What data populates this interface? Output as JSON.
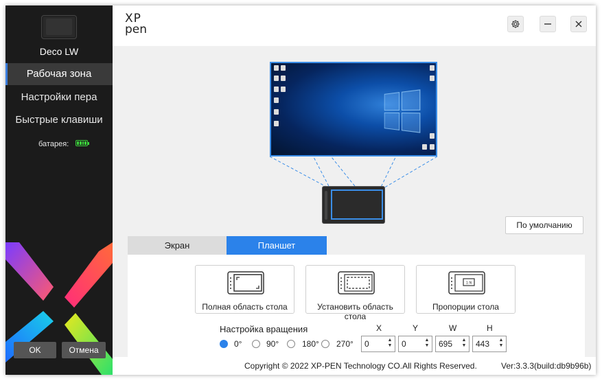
{
  "sidebar": {
    "device_name": "Deco LW",
    "items": [
      {
        "label": "Рабочая зона",
        "active": true
      },
      {
        "label": "Настройки пера",
        "active": false
      },
      {
        "label": "Быстрые клавиши",
        "active": false
      }
    ],
    "battery_label": "батарея:",
    "ok_label": "OK",
    "cancel_label": "Отмена"
  },
  "header": {
    "logo_line1": "XP",
    "logo_line2": "pen",
    "settings_icon": "gear-icon",
    "minimize_icon": "minimize-icon",
    "close_icon": "close-icon"
  },
  "main": {
    "default_button": "По умолчанию",
    "tabs": [
      {
        "label": "Экран",
        "active": false
      },
      {
        "label": "Планшет",
        "active": true
      }
    ],
    "modes": [
      {
        "label": "Полная область стола",
        "icon": "full-area-icon"
      },
      {
        "label": "Установить область стола",
        "icon": "set-area-icon"
      },
      {
        "label": "Пропорции стола",
        "icon": "proportion-icon"
      }
    ],
    "rotation_title": "Настройка вращения",
    "rotations": [
      {
        "label": "0°",
        "selected": true
      },
      {
        "label": "90°",
        "selected": false
      },
      {
        "label": "180°",
        "selected": false
      },
      {
        "label": "270°",
        "selected": false
      }
    ],
    "coords": [
      {
        "name": "X",
        "value": "0"
      },
      {
        "name": "Y",
        "value": "0"
      },
      {
        "name": "W",
        "value": "695"
      },
      {
        "name": "H",
        "value": "443"
      }
    ]
  },
  "footer": {
    "copyright": "Copyright © 2022  XP-PEN Technology CO.All Rights Reserved.",
    "version": "Ver:3.3.3(build:db9b96b)"
  },
  "colors": {
    "accent": "#2b82ea",
    "sidebar_bg": "#1b1b1b",
    "battery": "#3bd13b"
  }
}
